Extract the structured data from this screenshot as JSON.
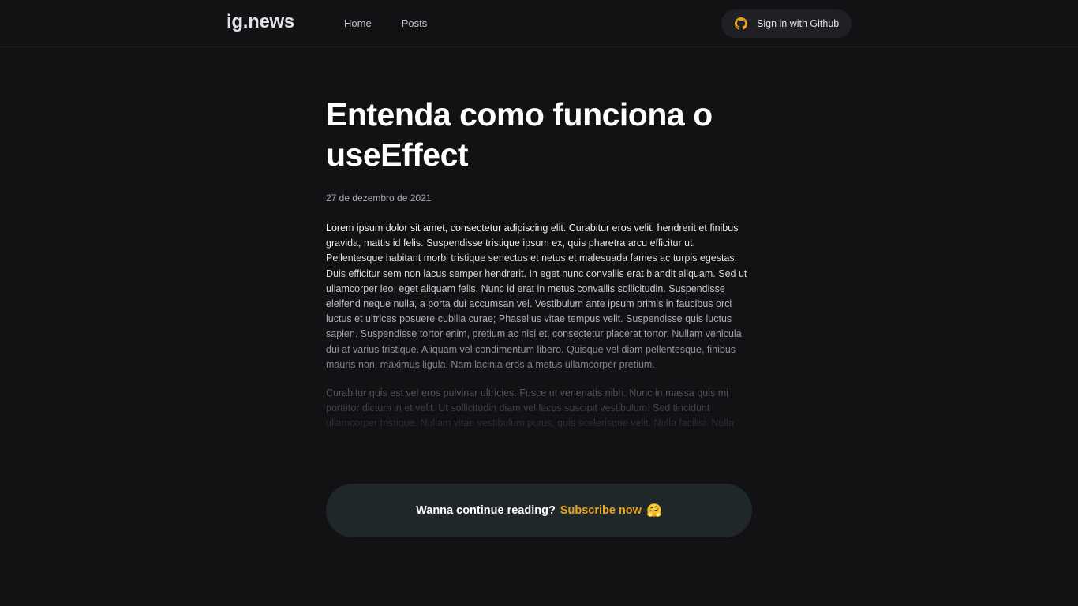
{
  "header": {
    "logo": "ig.news",
    "nav": [
      {
        "label": "Home"
      },
      {
        "label": "Posts"
      }
    ],
    "signin_label": "Sign in with Github",
    "signin_icon": "github-icon",
    "signin_icon_color": "#eba417"
  },
  "post": {
    "title": "Entenda como funciona o useEffect",
    "date": "27 de dezembro de 2021",
    "paragraphs": [
      "Lorem ipsum dolor sit amet, consectetur adipiscing elit. Curabitur eros velit, hendrerit et finibus gravida, mattis id felis. Suspendisse tristique ipsum ex, quis pharetra arcu efficitur ut. Pellentesque habitant morbi tristique senectus et netus et malesuada fames ac turpis egestas. Duis efficitur sem non lacus semper hendrerit. In eget nunc convallis erat blandit aliquam. Sed ut ullamcorper leo, eget aliquam felis. Nunc id erat in metus convallis sollicitudin. Suspendisse eleifend neque nulla, a porta dui accumsan vel. Vestibulum ante ipsum primis in faucibus orci luctus et ultrices posuere cubilia curae; Phasellus vitae tempus velit. Suspendisse quis luctus sapien. Suspendisse tortor enim, pretium ac nisi et, consectetur placerat tortor. Nullam vehicula dui at varius tristique. Aliquam vel condimentum libero. Quisque vel diam pellentesque, finibus mauris non, maximus ligula. Nam lacinia eros a metus ullamcorper pretium.",
      "Curabitur quis est vel eros pulvinar ultricies. Fusce ut venenatis nibh. Nunc in massa quis mi porttitor dictum in et velit. Ut sollicitudin diam vel lacus suscipit vestibulum. Sed tincidunt ullamcorper tristique. Nullam vitae vestibulum purus, quis scelerisque velit. Nulla facilisi. Nulla velit tellus, pharetra vel quam nec, ornare maximus tellus. Quisque ultricies commodo lacinia."
    ]
  },
  "cta": {
    "question": "Wanna continue reading?",
    "subscribe": "Subscribe now",
    "emoji": "🤗",
    "accent": "#eba417"
  }
}
